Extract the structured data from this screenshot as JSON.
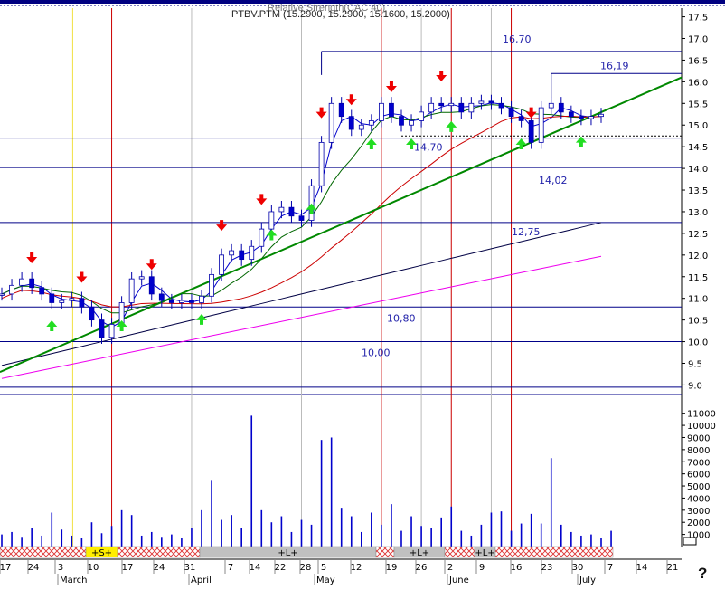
{
  "header": {
    "title_overlap": "Relative Strength(CAC 40)",
    "ticker_line": "PTBV.PTM (15.2900, 15.2900, 15.1600, 15.2000)"
  },
  "chart_data": {
    "type": "candlestick",
    "price_axis": {
      "ticks": [
        "17.5",
        "17.0",
        "16.5",
        "16.0",
        "15.5",
        "15.0",
        "14.5",
        "14.0",
        "13.5",
        "13.0",
        "12.5",
        "12.0",
        "11.5",
        "11.0",
        "10.5",
        "10.0",
        "9.5",
        "9.0"
      ],
      "range": [
        8.8,
        17.7
      ]
    },
    "volume_axis": {
      "ticks": [
        "11000",
        "10000",
        "9000",
        "8000",
        "7000",
        "6000",
        "5000",
        "4000",
        "3000",
        "2000",
        "1000"
      ],
      "range": [
        0,
        11500
      ]
    },
    "x_axis": {
      "day_labels": [
        "17",
        "24",
        "3",
        "10",
        "17",
        "24",
        "31",
        "7",
        "14",
        "22",
        "28",
        "5",
        "12",
        "19",
        "26",
        "2",
        "9",
        "16",
        "23",
        "30",
        "7",
        "14",
        "21"
      ],
      "month_labels": [
        "March",
        "April",
        "May",
        "June",
        "July"
      ]
    },
    "horizontal_levels": [
      {
        "label": "16,70",
        "value": 16.7
      },
      {
        "label": "16,19",
        "value": 16.19
      },
      {
        "label": "14,70",
        "value": 14.7
      },
      {
        "label": "14,02",
        "value": 14.02
      },
      {
        "label": "12,75",
        "value": 12.75
      },
      {
        "label": "10,80",
        "value": 10.8
      },
      {
        "label": "10,00",
        "value": 10.0
      }
    ],
    "dotted_level": 14.75,
    "extra_price_line": 8.95,
    "signal_bar": [
      {
        "label": "",
        "kind": "hatch"
      },
      {
        "label": "+S+",
        "kind": "yellow"
      },
      {
        "label": "",
        "kind": "hatch"
      },
      {
        "label": "+L+",
        "kind": "grey"
      },
      {
        "label": "",
        "kind": "hatch"
      },
      {
        "label": "+L+",
        "kind": "grey"
      },
      {
        "label": "",
        "kind": "hatch"
      },
      {
        "label": "+L+",
        "kind": "grey"
      },
      {
        "label": "",
        "kind": "hatch"
      }
    ],
    "closes": [
      11.1,
      11.3,
      11.45,
      11.25,
      11.1,
      10.9,
      10.95,
      11.0,
      10.8,
      10.5,
      10.1,
      10.4,
      10.9,
      11.45,
      11.5,
      11.1,
      10.95,
      10.9,
      10.95,
      10.9,
      11.05,
      11.55,
      12.0,
      12.1,
      11.9,
      12.2,
      12.6,
      13.0,
      13.1,
      12.9,
      12.8,
      13.6,
      14.6,
      15.5,
      15.2,
      14.9,
      15.0,
      15.1,
      15.5,
      15.2,
      15.0,
      15.1,
      15.3,
      15.5,
      15.45,
      15.5,
      15.3,
      15.5,
      15.55,
      15.5,
      15.4,
      15.2,
      15.1,
      14.6,
      15.4,
      15.5,
      15.3,
      15.2,
      15.15,
      15.2,
      15.25
    ],
    "volumes": [
      1000,
      1200,
      800,
      1500,
      900,
      2800,
      1400,
      900,
      700,
      2000,
      1100,
      1700,
      3000,
      2600,
      900,
      1200,
      800,
      1000,
      700,
      1500,
      3000,
      5500,
      2200,
      2600,
      1500,
      10800,
      3000,
      2000,
      2500,
      1200,
      2200,
      1800,
      8800,
      9000,
      3200,
      2500,
      1200,
      2800,
      1800,
      3500,
      1300,
      2500,
      1700,
      1500,
      2400,
      3300,
      1300,
      900,
      1800,
      2800,
      2900,
      1300,
      1900,
      2700,
      1900,
      7300,
      1800,
      1200,
      900,
      1000,
      700,
      1300
    ],
    "down_arrows": [
      3,
      8,
      15,
      22,
      26,
      32,
      35,
      39,
      44,
      53
    ],
    "up_arrows": [
      5,
      12,
      20,
      27,
      31,
      37,
      41,
      45,
      52,
      58
    ],
    "vertical_markers": {
      "red": [
        11,
        38,
        45,
        51
      ],
      "yellow": [
        8
      ],
      "grey": [
        19,
        30,
        42,
        49
      ]
    },
    "icons": {
      "legend_corner": "scroll-icon",
      "help": "question-mark-icon"
    },
    "help_text": "?",
    "colors": {
      "up_arrow": "#22dd22",
      "down_arrow": "#ee0000",
      "trendline": "#008800",
      "ma_fast": "#0000cc",
      "ma_mid": "#006600",
      "ma_slow": "#cc0000",
      "ma_long": "#000044",
      "ma_magenta": "#ee00ee",
      "level_line": "#000088",
      "label": "#2222aa"
    }
  }
}
